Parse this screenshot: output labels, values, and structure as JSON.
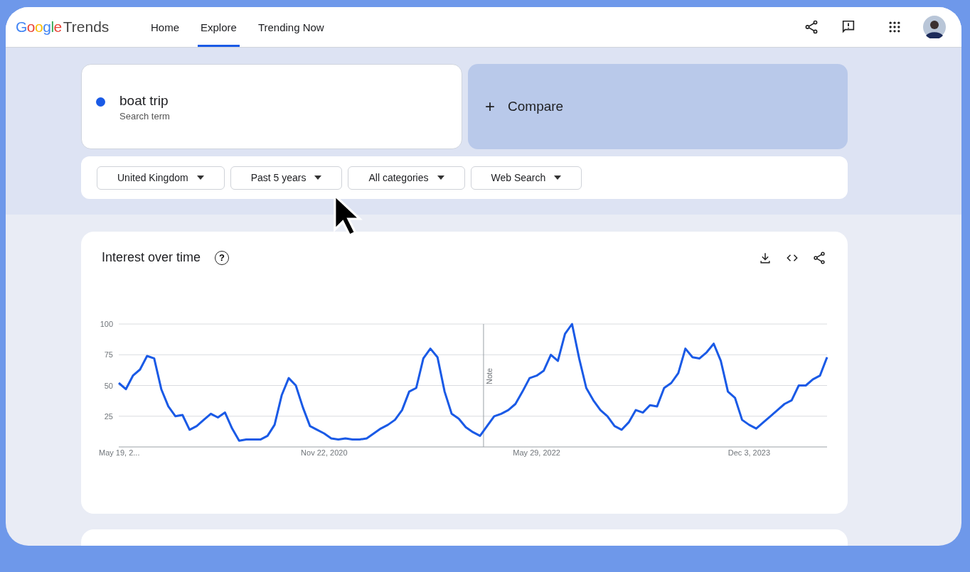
{
  "header": {
    "logo_google": "Google",
    "logo_product": "Trends",
    "nav": [
      {
        "label": "Home",
        "selected": false
      },
      {
        "label": "Explore",
        "selected": true
      },
      {
        "label": "Trending Now",
        "selected": false
      }
    ]
  },
  "search_term": {
    "term": "boat trip",
    "subtitle": "Search term",
    "color": "#1a5ae6"
  },
  "compare": {
    "icon": "+",
    "label": "Compare"
  },
  "filters": [
    "United Kingdom",
    "Past 5 years",
    "All categories",
    "Web Search"
  ],
  "interest_over_time": {
    "title": "Interest over time",
    "help": "?",
    "chart_data": {
      "type": "line",
      "categories": [
        "May 19, 2...",
        null,
        null,
        null,
        null,
        null,
        null,
        null,
        null,
        null,
        null,
        null,
        null,
        null,
        null,
        null,
        null,
        null,
        null,
        null,
        null,
        null,
        null,
        null,
        null,
        null,
        null,
        null,
        null,
        "Nov 22, 2020",
        null,
        null,
        null,
        null,
        null,
        null,
        null,
        null,
        null,
        null,
        null,
        null,
        null,
        null,
        null,
        null,
        null,
        null,
        null,
        null,
        null,
        null,
        null,
        null,
        null,
        null,
        null,
        null,
        null,
        "May 29, 2022",
        null,
        null,
        null,
        null,
        null,
        null,
        null,
        null,
        null,
        null,
        null,
        null,
        null,
        null,
        null,
        null,
        null,
        null,
        null,
        null,
        null,
        null,
        null,
        null,
        null,
        null,
        null,
        null,
        null,
        "Dec 3, 2023",
        null,
        null,
        null,
        null,
        null,
        null,
        null,
        null,
        null,
        null,
        null
      ],
      "series": [
        {
          "color": "#1a5ae6",
          "values": [
            52,
            47,
            58,
            63,
            74,
            72,
            47,
            33,
            25,
            26,
            14,
            17,
            22,
            27,
            24,
            28,
            15,
            5,
            6,
            6,
            6,
            9,
            18,
            42,
            56,
            50,
            32,
            17,
            14,
            11,
            7,
            6,
            7,
            6,
            6,
            7,
            11,
            15,
            18,
            22,
            30,
            45,
            48,
            72,
            80,
            73,
            45,
            27,
            23,
            16,
            12,
            9,
            17,
            25,
            27,
            30,
            35,
            45,
            56,
            58,
            62,
            75,
            70,
            92,
            100,
            72,
            48,
            38,
            30,
            25,
            17,
            14,
            20,
            30,
            28,
            34,
            33,
            48,
            52,
            60,
            80,
            73,
            72,
            77,
            84,
            70,
            45,
            40,
            22,
            18,
            15,
            20,
            25,
            30,
            35,
            38,
            50,
            50,
            55,
            58,
            73
          ]
        }
      ],
      "ylim": [
        0,
        100
      ],
      "yticks": [
        25,
        50,
        75,
        100
      ],
      "grid": true,
      "annotations": [
        "Note"
      ]
    }
  }
}
